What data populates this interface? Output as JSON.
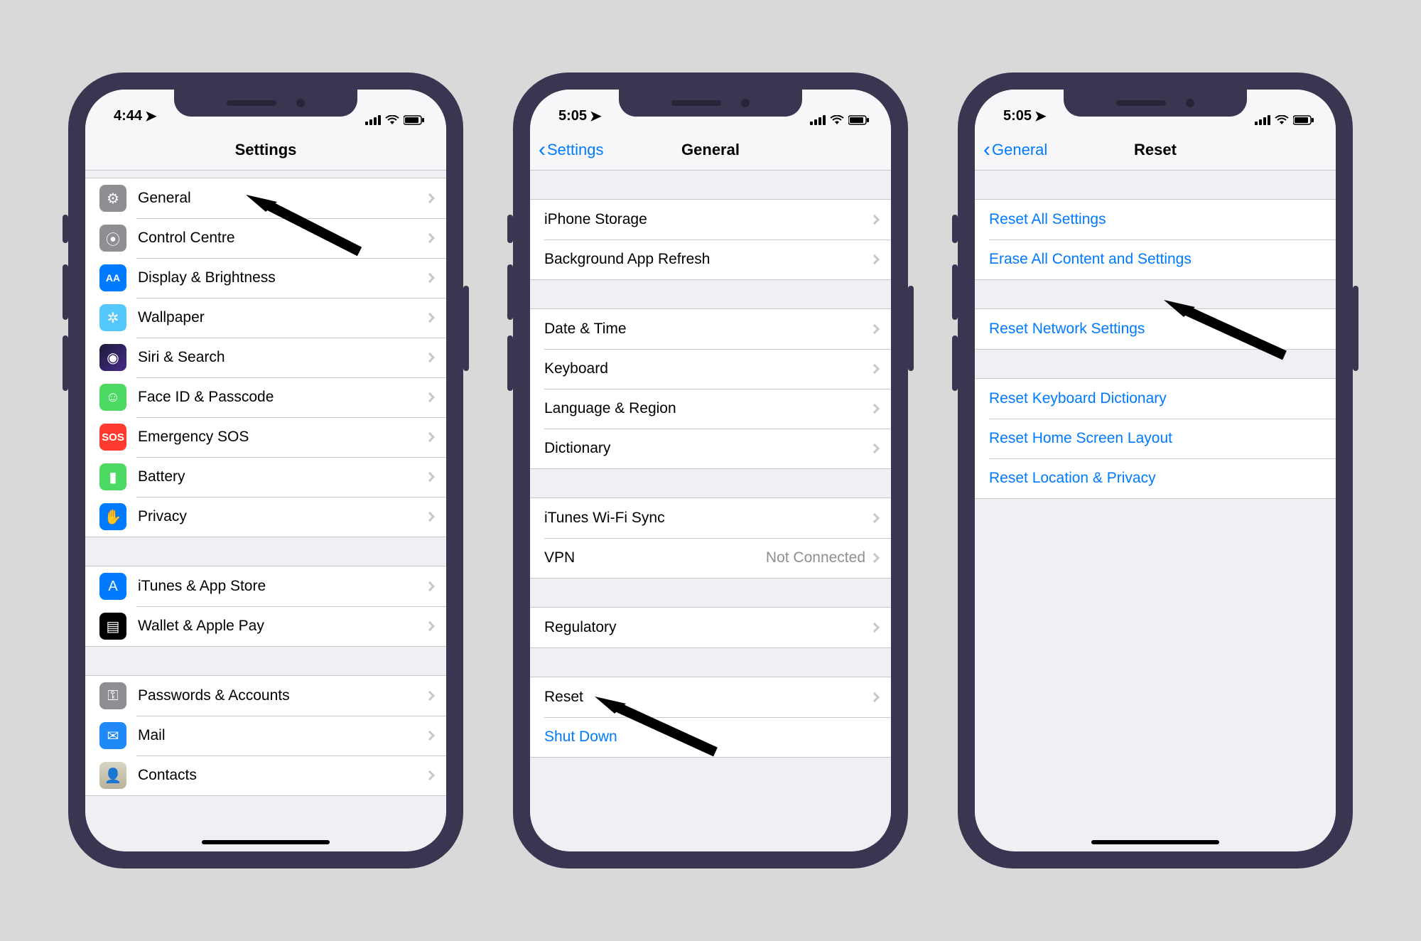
{
  "phones": {
    "settings": {
      "status_time": "4:44",
      "title": "Settings",
      "groups": [
        [
          {
            "icon": "gear-icon",
            "cls": "ic-general",
            "glyph": "⚙︎",
            "label": "General"
          },
          {
            "icon": "sliders-icon",
            "cls": "ic-control",
            "glyph": "⦿",
            "label": "Control Centre"
          },
          {
            "icon": "text-size-icon",
            "cls": "ic-display",
            "glyph": "AA",
            "label": "Display & Brightness"
          },
          {
            "icon": "flower-icon",
            "cls": "ic-wallpaper",
            "glyph": "✲",
            "label": "Wallpaper"
          },
          {
            "icon": "siri-icon",
            "cls": "ic-siri",
            "glyph": "◉",
            "label": "Siri & Search"
          },
          {
            "icon": "face-icon",
            "cls": "ic-faceid",
            "glyph": "☺",
            "label": "Face ID & Passcode"
          },
          {
            "icon": "sos-icon",
            "cls": "ic-sos",
            "glyph": "SOS",
            "label": "Emergency SOS"
          },
          {
            "icon": "battery-icon",
            "cls": "ic-battery",
            "glyph": "▮",
            "label": "Battery"
          },
          {
            "icon": "hand-icon",
            "cls": "ic-privacy",
            "glyph": "✋",
            "label": "Privacy"
          }
        ],
        [
          {
            "icon": "appstore-icon",
            "cls": "ic-appstore",
            "glyph": "A",
            "label": "iTunes & App Store"
          },
          {
            "icon": "wallet-icon",
            "cls": "ic-wallet",
            "glyph": "▤",
            "label": "Wallet & Apple Pay"
          }
        ],
        [
          {
            "icon": "key-icon",
            "cls": "ic-passwords",
            "glyph": "⚿",
            "label": "Passwords & Accounts"
          },
          {
            "icon": "mail-icon",
            "cls": "ic-mail",
            "glyph": "✉",
            "label": "Mail"
          },
          {
            "icon": "contacts-icon",
            "cls": "ic-contacts",
            "glyph": "👤",
            "label": "Contacts"
          }
        ]
      ]
    },
    "general": {
      "status_time": "5:05",
      "back": "Settings",
      "title": "General",
      "groups": [
        [
          {
            "label": "iPhone Storage"
          },
          {
            "label": "Background App Refresh"
          }
        ],
        [
          {
            "label": "Date & Time"
          },
          {
            "label": "Keyboard"
          },
          {
            "label": "Language & Region"
          },
          {
            "label": "Dictionary"
          }
        ],
        [
          {
            "label": "iTunes Wi-Fi Sync"
          },
          {
            "label": "VPN",
            "value": "Not Connected"
          }
        ],
        [
          {
            "label": "Regulatory"
          }
        ],
        [
          {
            "label": "Reset"
          },
          {
            "label": "Shut Down",
            "blue": true,
            "nochev": true
          }
        ]
      ]
    },
    "reset": {
      "status_time": "5:05",
      "back": "General",
      "title": "Reset",
      "groups": [
        [
          {
            "label": "Reset All Settings",
            "blue": true,
            "nochev": true
          },
          {
            "label": "Erase All Content and Settings",
            "blue": true,
            "nochev": true
          }
        ],
        [
          {
            "label": "Reset Network Settings",
            "blue": true,
            "nochev": true
          }
        ],
        [
          {
            "label": "Reset Keyboard Dictionary",
            "blue": true,
            "nochev": true
          },
          {
            "label": "Reset Home Screen Layout",
            "blue": true,
            "nochev": true
          },
          {
            "label": "Reset Location & Privacy",
            "blue": true,
            "nochev": true
          }
        ]
      ]
    }
  }
}
